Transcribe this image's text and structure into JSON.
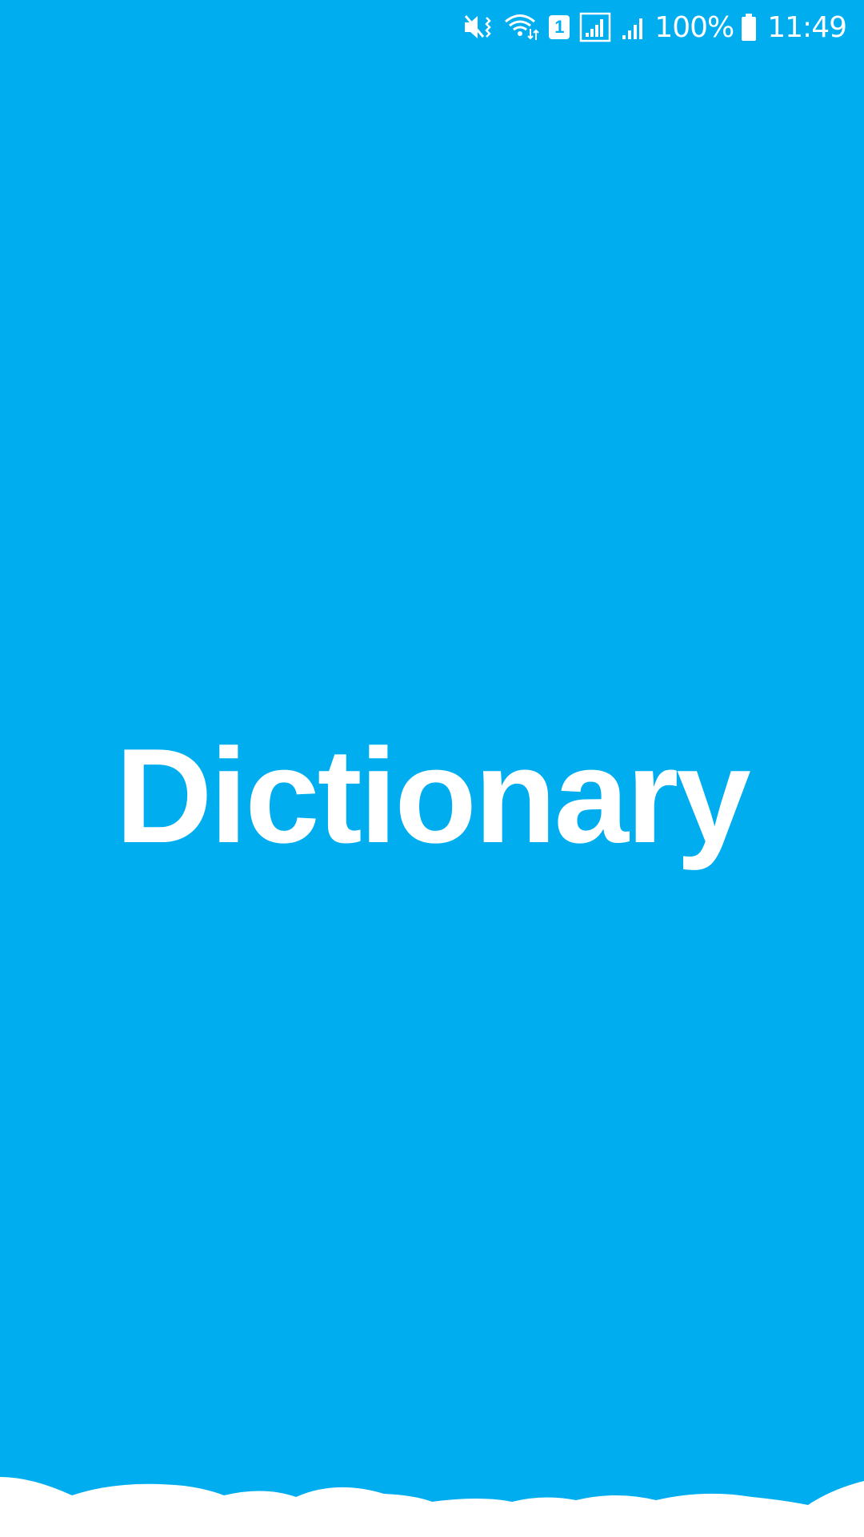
{
  "theme": {
    "background": "#00aef0",
    "foreground": "#ffffff"
  },
  "status_bar": {
    "icons": [
      "mute-vibrate-icon",
      "wifi-icon",
      "sim-1-icon",
      "signal-sim1-icon",
      "signal-sim2-icon",
      "battery-icon"
    ],
    "sim_label": "1",
    "battery_percent": "100%",
    "time": "11:49"
  },
  "splash": {
    "title": "Dictionary"
  }
}
